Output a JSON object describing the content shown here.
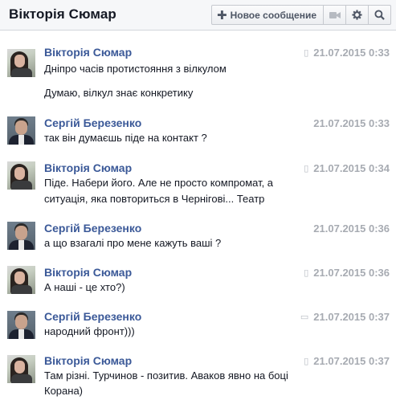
{
  "header": {
    "title": "Вікторія Сюмар",
    "new_message_label": "Новое сообщение"
  },
  "messages": [
    {
      "author": "Вікторія Сюмар",
      "time": "21.07.2015 0:33",
      "source": "mobile",
      "lines": [
        "Дніпро часів протистояння з вілкулом",
        "Думаю, вілкул знає конкретику"
      ]
    },
    {
      "author": "Сергій Березенко",
      "time": "21.07.2015 0:33",
      "source": "",
      "lines": [
        "так він думаєшь піде на контакт ?"
      ]
    },
    {
      "author": "Вікторія Сюмар",
      "time": "21.07.2015 0:34",
      "source": "mobile",
      "lines": [
        "Піде. Набери його. Але не просто компромат, а",
        "ситуація, яка повториться в Чернігові... Театр"
      ]
    },
    {
      "author": "Сергій Березенко",
      "time": "21.07.2015 0:36",
      "source": "",
      "lines": [
        "а що взагалі про мене кажуть ваші ?"
      ]
    },
    {
      "author": "Вікторія Сюмар",
      "time": "21.07.2015 0:36",
      "source": "mobile",
      "lines": [
        "А наші - це хто?)"
      ]
    },
    {
      "author": "Сергій Березенко",
      "time": "21.07.2015 0:37",
      "source": "chat",
      "lines": [
        "народний фронт)))"
      ]
    },
    {
      "author": "Вікторія Сюмар",
      "time": "21.07.2015 0:37",
      "source": "mobile",
      "lines": [
        "Там різні. Турчинов - позитив. Аваков явно на боці",
        "Корана)"
      ]
    }
  ]
}
